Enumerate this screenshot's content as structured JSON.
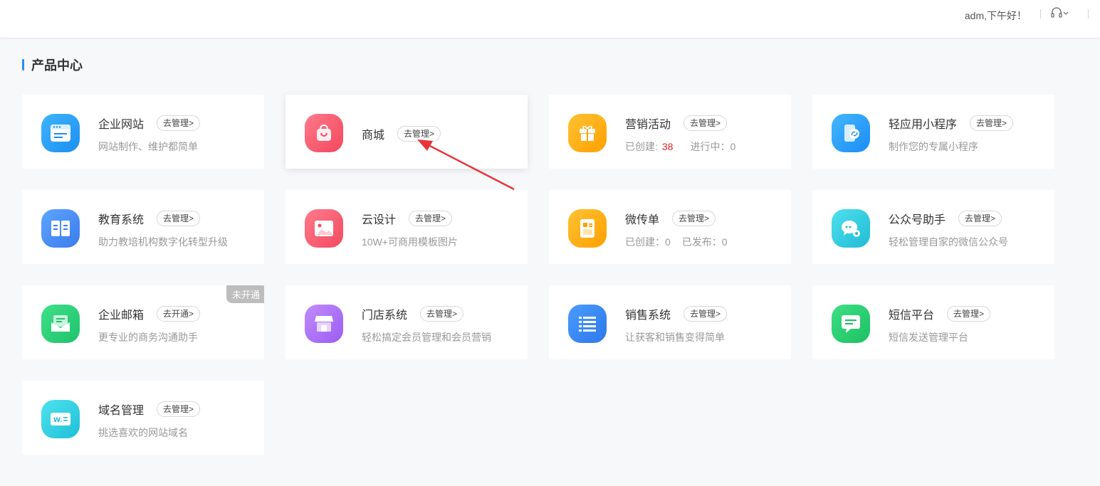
{
  "header": {
    "greeting": "adm,下午好！"
  },
  "section": {
    "title": "产品中心"
  },
  "products": [
    {
      "name": "企业网站",
      "action": "去管理>",
      "desc": "网站制作、维护都简单",
      "icon": "website-icon"
    },
    {
      "name": "商城",
      "action": "去管理>",
      "desc": "",
      "icon": "shopping-bag-icon"
    },
    {
      "name": "营销活动",
      "action": "去管理>",
      "created_label": "已创建:",
      "created_value": "38",
      "running_label": "进行中：0",
      "icon": "gift-icon"
    },
    {
      "name": "轻应用小程序",
      "action": "去管理>",
      "desc": "制作您的专属小程序",
      "icon": "mini-program-icon"
    },
    {
      "name": "教育系统",
      "action": "去管理>",
      "desc": "助力教培机构数字化转型升级",
      "icon": "book-icon"
    },
    {
      "name": "云设计",
      "action": "去管理>",
      "desc": "10W+可商用模板图片",
      "icon": "image-icon"
    },
    {
      "name": "微传单",
      "action": "去管理>",
      "created": "已创建：0",
      "published": "已发布：0",
      "icon": "flyer-icon"
    },
    {
      "name": "公众号助手",
      "action": "去管理>",
      "desc": "轻松管理自家的微信公众号",
      "icon": "wechat-icon"
    },
    {
      "name": "企业邮箱",
      "action": "去开通>",
      "desc": "更专业的商务沟通助手",
      "badge": "未开通",
      "icon": "mail-icon"
    },
    {
      "name": "门店系统",
      "action": "去管理>",
      "desc": "轻松搞定会员管理和会员营销",
      "icon": "store-icon"
    },
    {
      "name": "销售系统",
      "action": "去管理>",
      "desc": "让获客和销售变得简单",
      "icon": "list-icon"
    },
    {
      "name": "短信平台",
      "action": "去管理>",
      "desc": "短信发送管理平台",
      "icon": "sms-icon"
    },
    {
      "name": "域名管理",
      "action": "去管理>",
      "desc": "挑选喜欢的网站域名",
      "icon": "domain-icon"
    }
  ],
  "colors": {
    "accent": "#2d8cf0",
    "red": "#e02424"
  }
}
